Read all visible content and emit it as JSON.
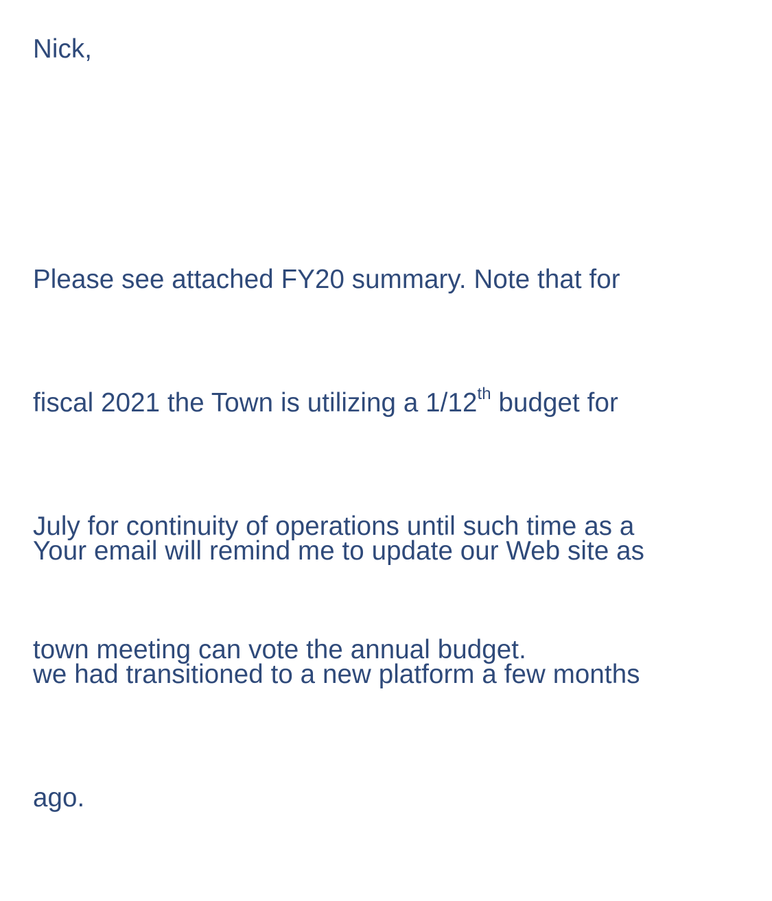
{
  "email": {
    "greeting": "Nick,",
    "paragraph1": {
      "line1": "Please see attached FY20 summary.  Note that for",
      "line2_before_sup": "fiscal 2021 the Town is utilizing a 1/12",
      "line2_sup": "th",
      "line2_after_sup": " budget for",
      "line3": "July for continuity of operations until such time as a",
      "line4": "town meeting can vote the annual budget."
    },
    "paragraph2": {
      "line1": "Your email will remind me to update our Web site as",
      "line2": "we had transitioned to a new platform a few months",
      "line3": "ago."
    }
  },
  "colors": {
    "text": "#2f4a7a",
    "background": "#ffffff"
  }
}
